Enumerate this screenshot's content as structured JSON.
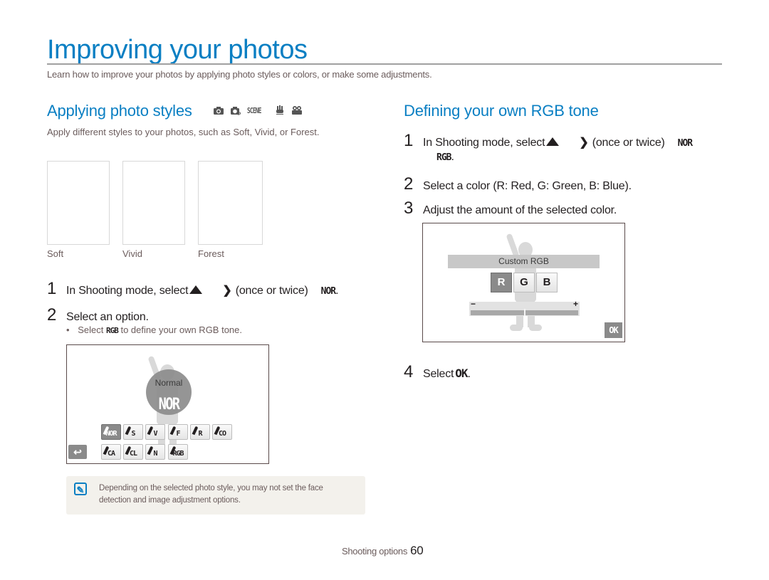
{
  "page": {
    "title": "Improving your photos",
    "intro": "Learn how to improve your photos by applying photo styles or colors, or make some adjustments."
  },
  "left": {
    "heading": "Applying photo styles",
    "mode_icons": [
      "camera-icon",
      "smart-auto-icon",
      "scene-mode-icon",
      "dual-is-icon",
      "movie-icon"
    ],
    "scene_label": "SCENE",
    "description": "Apply different styles to your photos, such as Soft, Vivid, or Forest.",
    "thumbnails": [
      {
        "label": "Soft"
      },
      {
        "label": "Vivid"
      },
      {
        "label": "Forest"
      }
    ],
    "steps": [
      {
        "num": "1",
        "text_before": "In Shooting mode, select",
        "text_after": "(once or twice)",
        "end_glyph": "NOR",
        "end_punct": "."
      },
      {
        "num": "2",
        "text": "Select an option."
      }
    ],
    "bullet": {
      "before": "Select",
      "glyph": "RGB",
      "after": "to define your own RGB tone."
    },
    "screen": {
      "overlay_label": "Normal",
      "overlay_glyph": "NOR",
      "style_buttons_row1": [
        "NOR",
        "S",
        "V",
        "F",
        "R",
        "CO"
      ],
      "style_buttons_row2": [
        "CA",
        "CL",
        "N",
        "RGB"
      ],
      "selected_style": "NOR",
      "back_glyph": "↩"
    },
    "note": {
      "icon": "note-pencil-icon",
      "text": "Depending on the selected photo style, you may not set the face detection and image adjustment options."
    }
  },
  "right": {
    "heading": "Defining your own RGB tone",
    "steps": [
      {
        "num": "1",
        "text_before": "In Shooting mode, select",
        "text_after": "(once or twice)",
        "end_glyph": "NOR",
        "continuation_glyph": "RGB",
        "end_punct": "."
      },
      {
        "num": "2",
        "text": "Select a color (R: Red, G: Green, B: Blue)."
      },
      {
        "num": "3",
        "text": "Adjust the amount of the selected color."
      },
      {
        "num": "4",
        "text_before": "Select",
        "glyph": "OK",
        "end_punct": "."
      }
    ],
    "screen": {
      "title": "Custom RGB",
      "channels": [
        "R",
        "G",
        "B"
      ],
      "selected_channel": "R",
      "slider_minus": "−",
      "slider_plus": "+",
      "slider_value_fraction": 0.5,
      "ok_label": "OK"
    }
  },
  "footer": {
    "section": "Shooting options",
    "page_number": "60"
  }
}
